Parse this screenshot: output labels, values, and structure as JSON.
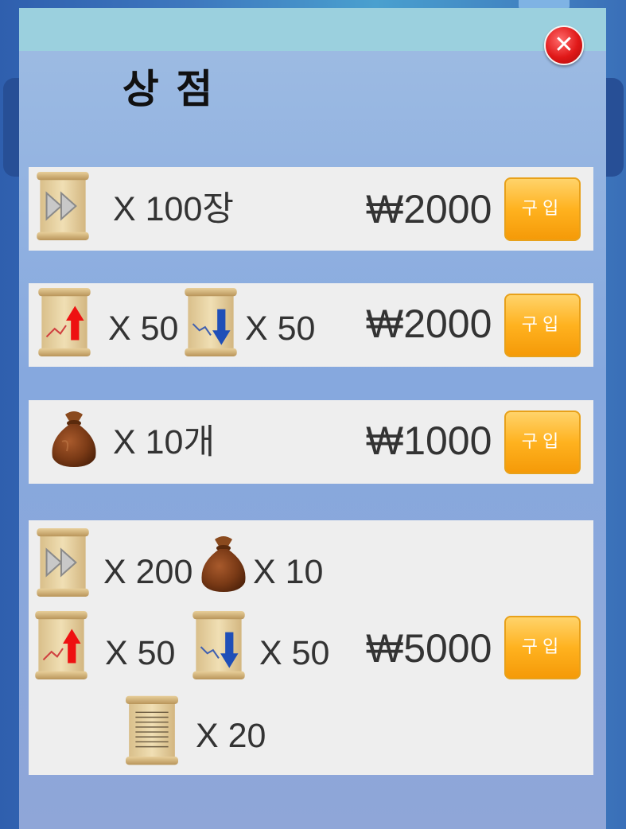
{
  "shop": {
    "title": "상 점",
    "close_icon": "close-icon",
    "items": [
      {
        "qty": "X 100장",
        "price": "₩2000",
        "buy_label": "구입"
      },
      {
        "qty_up": "X 50",
        "qty_down": "X 50",
        "price": "₩2000",
        "buy_label": "구입"
      },
      {
        "qty": "X 10개",
        "price": "₩1000",
        "buy_label": "구입"
      },
      {
        "qty_skip": "X 200",
        "qty_bag": "X 10",
        "qty_up": "X 50",
        "qty_down": "X 50",
        "qty_doc": "X 20",
        "price": "₩5000",
        "buy_label": "구입"
      }
    ]
  },
  "icons": [
    "skip-scroll-icon",
    "rise-scroll-icon",
    "fall-scroll-icon",
    "money-bag-icon",
    "document-scroll-icon"
  ],
  "colors": {
    "buy_button": "#ffb21f",
    "row_bg": "#eeeeee",
    "close": "#e01818"
  }
}
